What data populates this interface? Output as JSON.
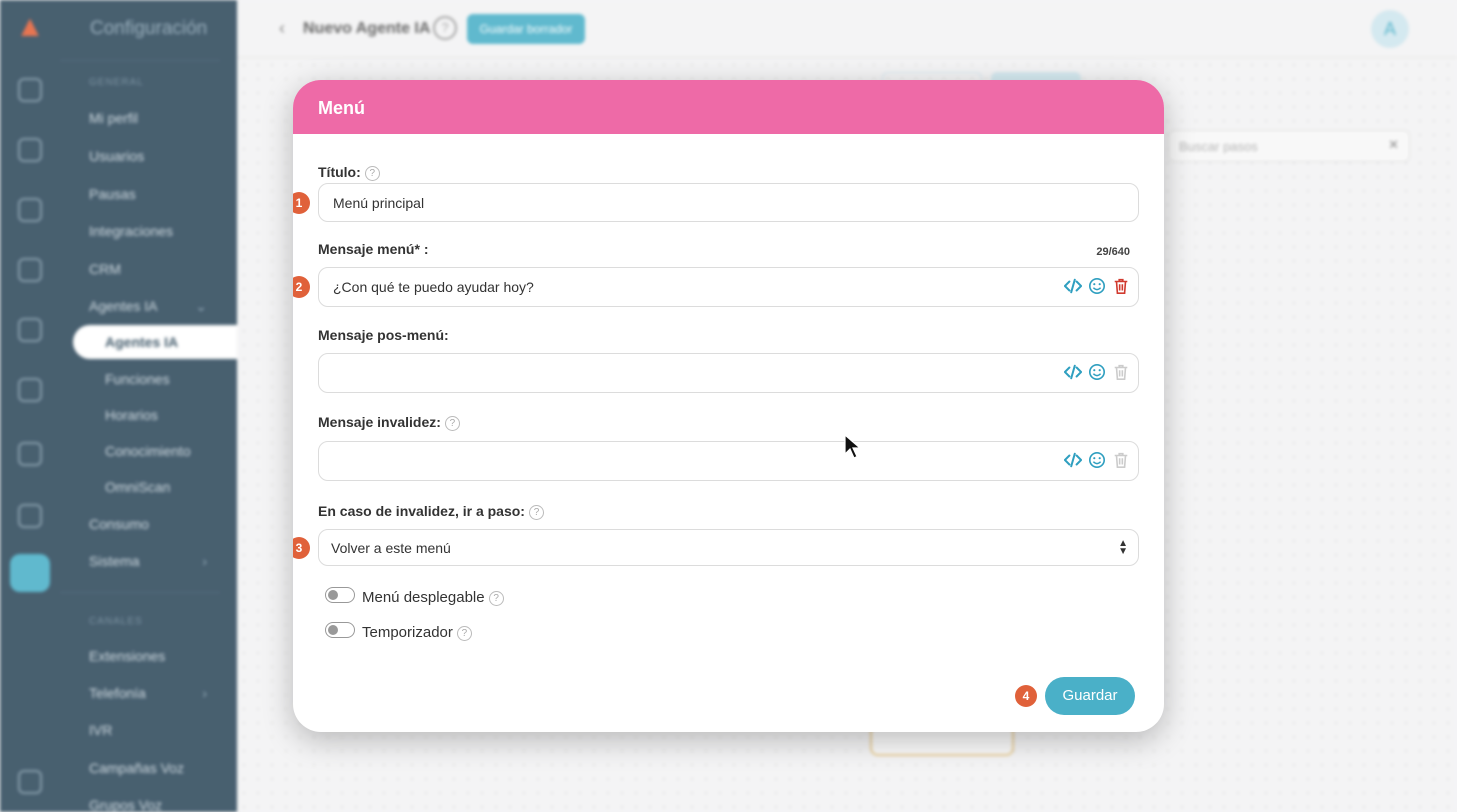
{
  "sidebar": {
    "title": "Configuración",
    "section_general": "GENERAL",
    "section_channels": "CANALES",
    "items": [
      {
        "label": "Mi perfil"
      },
      {
        "label": "Usuarios"
      },
      {
        "label": "Pausas"
      },
      {
        "label": "Integraciones"
      },
      {
        "label": "CRM"
      },
      {
        "label": "Agentes IA"
      },
      {
        "label": "Agentes IA"
      },
      {
        "label": "Funciones"
      },
      {
        "label": "Horarios"
      },
      {
        "label": "Conocimiento"
      },
      {
        "label": "OmniScan"
      },
      {
        "label": "Consumo"
      },
      {
        "label": "Sistema"
      },
      {
        "label": "Extensiones"
      },
      {
        "label": "Telefonía"
      },
      {
        "label": "IVR"
      },
      {
        "label": "Campañas Voz"
      },
      {
        "label": "Grupos Voz"
      }
    ]
  },
  "topbar": {
    "title": "Nuevo Agente IA",
    "help": "?",
    "draft_button": "Guardar borrador",
    "avatar": "A"
  },
  "canvas": {
    "search_placeholder": "Buscar pasos"
  },
  "modal": {
    "title": "Menú",
    "titulo_label": "Título:",
    "titulo_value": "Menú principal",
    "mensaje_menu_label": "Mensaje menú* :",
    "mensaje_menu_value": "¿Con qué te puedo ayudar hoy?",
    "counter": "29/640",
    "pos_menu_label": "Mensaje pos-menú:",
    "pos_menu_value": "",
    "invalidez_label": "Mensaje invalidez:",
    "invalidez_value": "",
    "invalid_goto_label": "En caso de invalidez, ir a paso:",
    "invalid_goto_value": "Volver a este menú",
    "toggle_dropdown_label": "Menú desplegable",
    "toggle_timer_label": "Temporizador",
    "save_button": "Guardar",
    "badges": [
      "1",
      "2",
      "3",
      "4"
    ],
    "accent_color": "#ee6aa7",
    "primary_color": "#4ab0c8",
    "badge_color": "#e0613a"
  }
}
